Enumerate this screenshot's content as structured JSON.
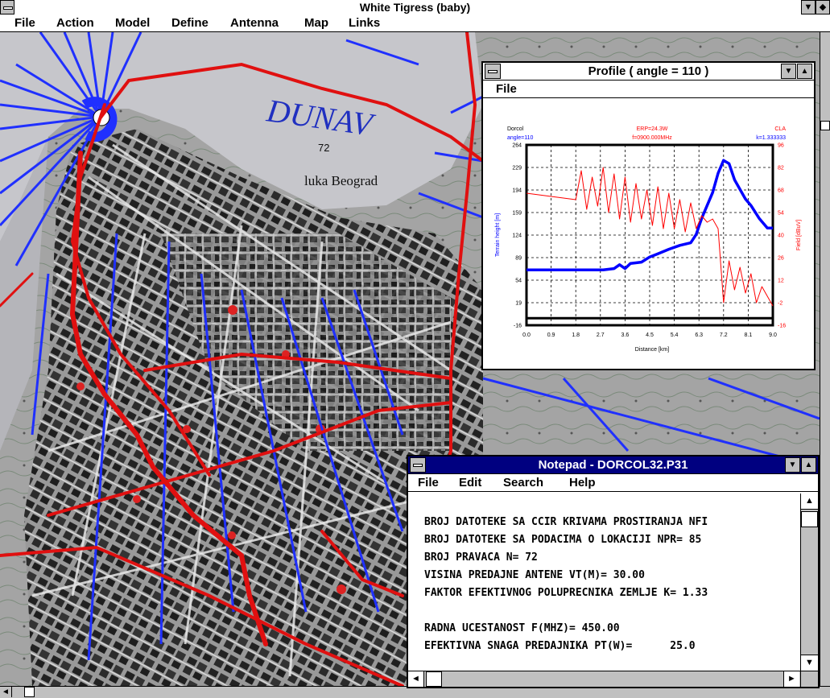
{
  "app": {
    "title": "White Tigress (baby)"
  },
  "menubar": [
    "File",
    "Action",
    "Model",
    "Define",
    "Antenna",
    "Map",
    "Links"
  ],
  "map_labels": {
    "river": "DUNAV",
    "port": "luka Beograd",
    "elevation": "72"
  },
  "profile_window": {
    "title": "Profile ( angle = 110 )",
    "menu": [
      "File"
    ],
    "chart_data": {
      "type": "line",
      "header_left": [
        "Dorcol",
        "angle=110"
      ],
      "header_center": [
        "ERP=24.3W",
        "f=0900.000MHz"
      ],
      "header_right": [
        "CLA",
        "k=1.333333"
      ],
      "xlabel": "Distance [km]",
      "ylabel_left": "Terrain height [m]",
      "ylabel_right": "Field [dBuV]",
      "x_ticks": [
        "0.0",
        "0.9",
        "1.8",
        "2.7",
        "3.6",
        "4.5",
        "5.4",
        "6.3",
        "7.2",
        "8.1",
        "9.0"
      ],
      "y_left_ticks": [
        "-16",
        "19",
        "54",
        "89",
        "124",
        "159",
        "194",
        "229",
        "264"
      ],
      "y_right_ticks": [
        "-16",
        "-2",
        "12",
        "26",
        "40",
        "54",
        "68",
        "82",
        "96"
      ],
      "xlim": [
        0,
        9
      ],
      "ylim_left": [
        -16,
        264
      ],
      "ylim_right": [
        -16,
        96
      ],
      "grid": true,
      "series": [
        {
          "color": "#0000ff",
          "axis": "left",
          "x": [
            0.0,
            1.0,
            2.0,
            2.8,
            3.2,
            3.4,
            3.6,
            3.8,
            4.2,
            4.5,
            4.8,
            5.2,
            5.6,
            6.0,
            6.2,
            6.4,
            6.6,
            6.8,
            7.0,
            7.2,
            7.4,
            7.6,
            7.8,
            8.0,
            8.2,
            8.5,
            8.8,
            9.0
          ],
          "y": [
            70,
            70,
            70,
            70,
            72,
            78,
            72,
            80,
            82,
            90,
            95,
            102,
            108,
            112,
            125,
            150,
            170,
            190,
            220,
            240,
            235,
            210,
            195,
            180,
            170,
            150,
            135,
            135
          ]
        },
        {
          "color": "#ff0000",
          "axis": "right",
          "x": [
            0.0,
            1.8,
            2.0,
            2.2,
            2.4,
            2.6,
            2.8,
            3.0,
            3.2,
            3.4,
            3.6,
            3.8,
            4.0,
            4.2,
            4.4,
            4.6,
            4.8,
            5.0,
            5.2,
            5.4,
            5.6,
            5.8,
            6.0,
            6.2,
            6.4,
            6.6,
            6.8,
            7.0,
            7.2,
            7.4,
            7.6,
            7.8,
            8.0,
            8.2,
            8.4,
            8.6,
            9.0
          ],
          "y": [
            66,
            62,
            80,
            56,
            76,
            58,
            82,
            54,
            78,
            50,
            76,
            48,
            72,
            50,
            68,
            46,
            70,
            44,
            66,
            44,
            62,
            42,
            60,
            44,
            52,
            48,
            50,
            44,
            -2,
            24,
            6,
            20,
            4,
            16,
            -2,
            8,
            -4
          ]
        },
        {
          "color": "#000000",
          "axis": "left",
          "x": [
            0.0,
            9.0
          ],
          "y": [
            -5,
            -5
          ]
        }
      ]
    }
  },
  "notepad_window": {
    "title": "Notepad - DORCOL32.P31",
    "menu": [
      "File",
      "Edit",
      "Search",
      "Help"
    ],
    "lines": [
      "BROJ DATOTEKE SA CCIR KRIVAMA PROSTIRANJA NFI",
      "BROJ DATOTEKE SA PODACIMA O LOKACIJI NPR= 85",
      "BROJ PRAVACA N= 72",
      "VISINA PREDAJNE ANTENE VT(M)= 30.00",
      "FAKTOR EFEKTIVNOG POLUPRECNIKA ZEMLJE K= 1.33",
      "",
      "RADNA UCESTANOST F(MHZ)= 450.00",
      "EFEKTIVNA SNAGA PREDAJNIKA PT(W)=      25.0"
    ]
  },
  "colors": {
    "route": "#e01010",
    "radial": "#2030ff",
    "map_bg": "#9a9a9a",
    "water": "#c8c8cc",
    "notepad_title": "#000080"
  },
  "icons": {
    "system_menu": "control-menu-icon",
    "minimize": "down-triangle-icon",
    "maximize": "up-triangle-icon",
    "scroll_up": "up-arrow-icon",
    "scroll_down": "down-arrow-icon",
    "scroll_left": "left-arrow-icon",
    "scroll_right": "right-arrow-icon"
  }
}
